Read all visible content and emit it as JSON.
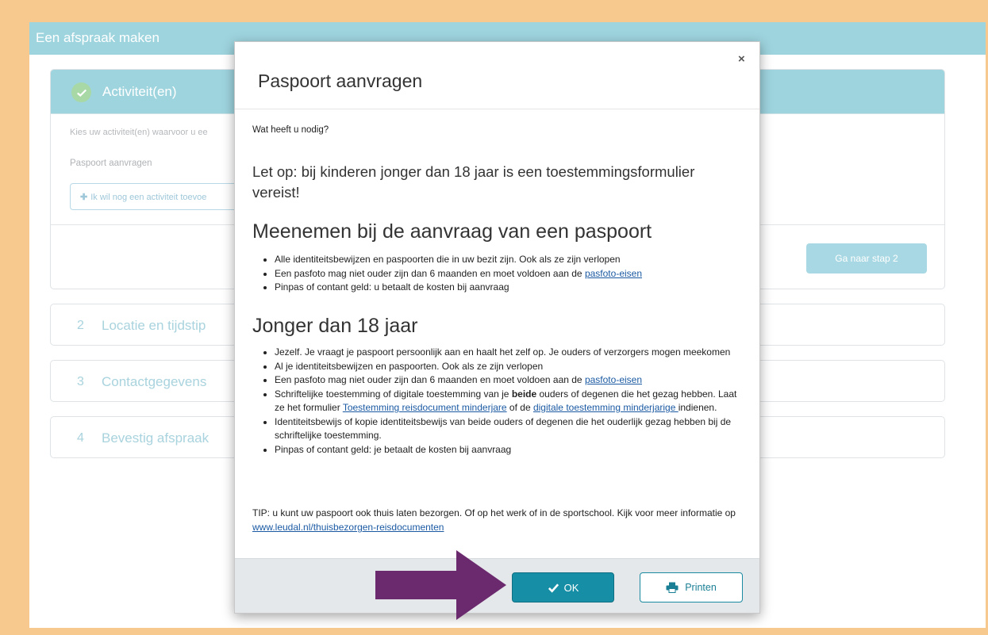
{
  "app": {
    "title": "Een afspraak maken"
  },
  "steps": {
    "step1": {
      "title": "Activiteit(en)",
      "hint": "Kies uw activiteit(en) waarvoor u ee",
      "activity": "Paspoort aanvragen",
      "add_label": "Ik wil nog een activiteit toevoe",
      "next_label": "Ga naar stap 2"
    },
    "items": [
      {
        "num": "2",
        "label": "Locatie en tijdstip"
      },
      {
        "num": "3",
        "label": "Contactgegevens"
      },
      {
        "num": "4",
        "label": "Bevestig afspraak"
      }
    ]
  },
  "modal": {
    "title": "Paspoort aanvragen",
    "close": "×",
    "question": "Wat heeft u nodig?",
    "notice": "Let op: bij kinderen jonger dan 18 jaar is een toestemmingsformulier vereist!",
    "section1": {
      "heading": "Meenemen bij de aanvraag van een paspoort",
      "items": [
        "Alle identiteitsbewijzen en paspoorten die in uw bezit zijn. Ook als ze zijn verlopen",
        "Een pasfoto mag niet ouder zijn dan 6 maanden en moet voldoen aan de ",
        "Pinpas of contant geld: u betaalt de kosten bij aanvraag"
      ],
      "link_pasfoto": "pasfoto-eisen"
    },
    "section2": {
      "heading": "Jonger dan 18 jaar",
      "item1": "Jezelf. Je vraagt je paspoort persoonlijk aan en haalt het zelf op. Je ouders of verzorgers mogen meekomen",
      "item2": "Al je identiteitsbewijzen en paspoorten. Ook als ze zijn verlopen",
      "item3": "Een pasfoto mag niet ouder zijn dan 6 maanden en moet voldoen aan de ",
      "item3_link": "pasfoto-eisen",
      "item4_a": "Schriftelijke toestemming of digitale toestemming van je ",
      "item4_bold": "beide",
      "item4_b": " ouders of degenen die het gezag hebben. Laat ze het formulier ",
      "item4_link1": "Toestemming reisdocument minderjare",
      "item4_c": " of de ",
      "item4_link2": "digitale toestemming minderjarige ",
      "item4_d": "indienen.",
      "item5": "Identiteitsbewijs of kopie identiteitsbewijs van beide ouders of degenen die het ouderlijk gezag hebben bij de schriftelijke toestemming.",
      "item6": "Pinpas of contant geld: je betaalt de kosten bij aanvraag"
    },
    "tip_text": "TIP: u kunt uw paspoort ook thuis laten bezorgen. Of op het werk of in de sportschool. Kijk voor meer informatie op ",
    "tip_link": "www.leudal.nl/thuisbezorgen-reisdocumenten",
    "ok_label": "OK",
    "print_label": "Printen"
  },
  "colors": {
    "header": "#9ed4de",
    "primary_button": "#168fa6",
    "arrow": "#6b2a6e",
    "page_border": "#f7c98e"
  },
  "icons": [
    "check-icon",
    "plus-icon",
    "close-icon",
    "checkmark-icon",
    "printer-icon",
    "arrow-pointer-icon"
  ]
}
